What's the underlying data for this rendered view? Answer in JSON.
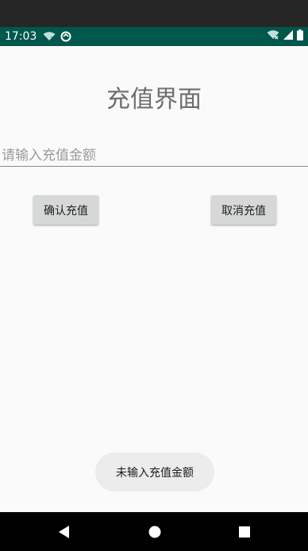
{
  "status_bar": {
    "time": "17:03",
    "icons": [
      "wifi-question-icon",
      "sync-icon",
      "wifi-x-icon",
      "signal-icon",
      "battery-icon"
    ]
  },
  "page": {
    "title": "充值界面"
  },
  "amount_input": {
    "placeholder": "请输入充值金额",
    "value": ""
  },
  "buttons": {
    "confirm_label": "确认充值",
    "cancel_label": "取消充值"
  },
  "toast": {
    "message": "未输入充值金额"
  },
  "nav_bar": {
    "icons": [
      "back-icon",
      "home-icon",
      "recents-icon"
    ]
  },
  "colors": {
    "status_bar": "#00574b",
    "background": "#fafafa",
    "button": "#d6d7d7",
    "toast": "#ececec",
    "nav_bar": "#000000"
  }
}
